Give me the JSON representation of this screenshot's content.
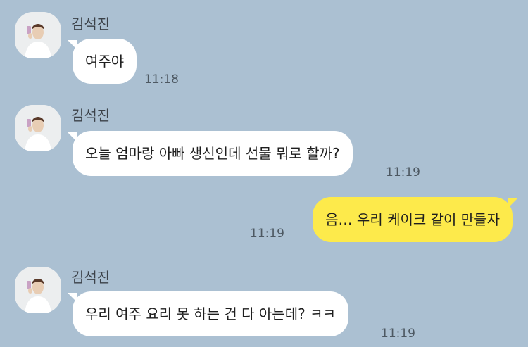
{
  "colors": {
    "background": "#abc0d2",
    "incoming_bubble": "#ffffff",
    "outgoing_bubble": "#fdea4b"
  },
  "messages": [
    {
      "sender": "김석진",
      "text": "여주야",
      "time": "11:18",
      "direction": "incoming"
    },
    {
      "sender": "김석진",
      "text": "오늘 엄마랑 아빠 생신인데 선물 뭐로 할까?",
      "time": "11:19",
      "direction": "incoming"
    },
    {
      "sender": "",
      "text": "음… 우리 케이크 같이 만들자",
      "time": "11:19",
      "direction": "outgoing"
    },
    {
      "sender": "김석진",
      "text": "우리 여주 요리 못 하는 건 다 아는데? ㅋㅋ",
      "time": "11:19",
      "direction": "incoming"
    }
  ]
}
